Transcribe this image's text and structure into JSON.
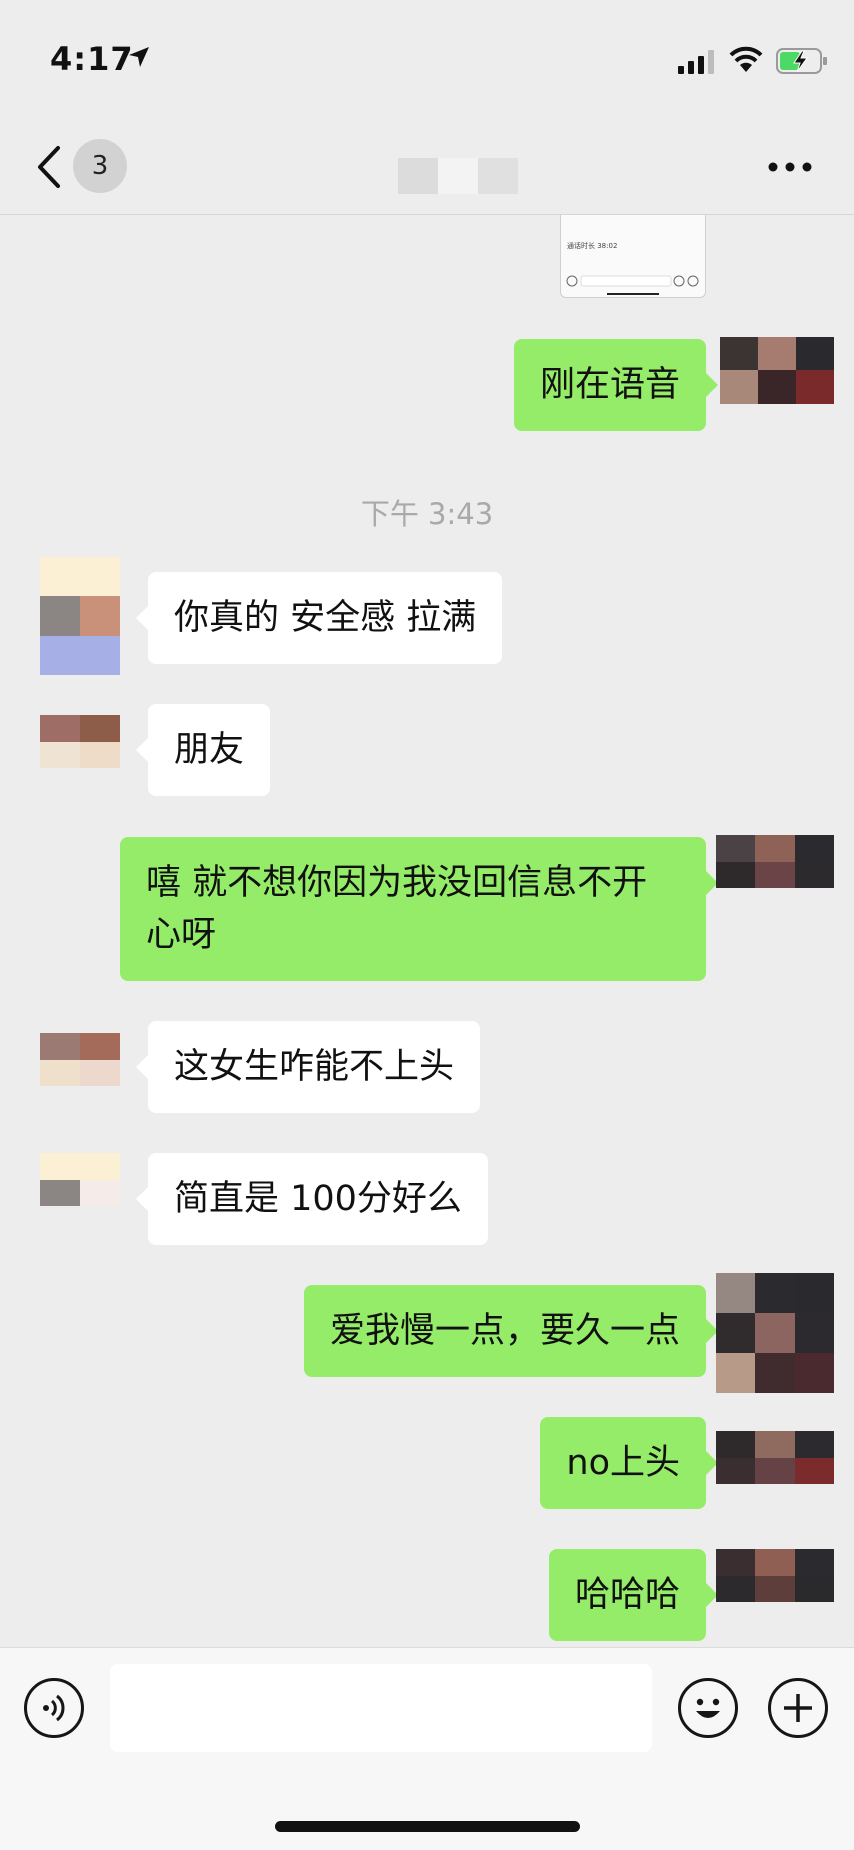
{
  "status_bar": {
    "time": "4:17",
    "icons": [
      "location-arrow-icon",
      "signal-icon",
      "wifi-icon",
      "battery-charging-icon"
    ]
  },
  "nav": {
    "unread_count": "3",
    "icons": [
      "back-chevron-icon",
      "more-dots-icon"
    ]
  },
  "timestamp": "下午 3:43",
  "screenshot_thumbnail": {
    "call_text": "通话时长 38:02"
  },
  "messages": [
    {
      "side": "right",
      "text": "刚在语音"
    },
    {
      "side": "left",
      "text": "你真的 安全感 拉满"
    },
    {
      "side": "left",
      "text": "朋友"
    },
    {
      "side": "right",
      "text": "嘻  就不想你因为我没回信息不开心呀"
    },
    {
      "side": "left",
      "text": "这女生咋能不上头"
    },
    {
      "side": "left",
      "text": "简直是 100分好么"
    },
    {
      "side": "right",
      "text": "爱我慢一点，要久一点"
    },
    {
      "side": "right",
      "text": "no上头"
    },
    {
      "side": "right",
      "text": "哈哈哈"
    }
  ],
  "input_bar": {
    "value": "",
    "icons": [
      "voice-icon",
      "emoji-icon",
      "plus-icon"
    ]
  },
  "colors": {
    "bg": "#ededed",
    "outgoing": "#95ec69",
    "incoming": "#ffffff"
  }
}
